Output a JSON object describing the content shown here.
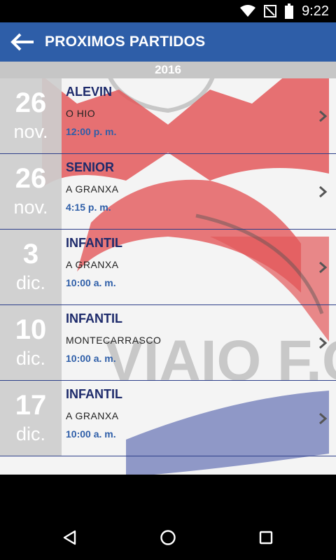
{
  "status_bar": {
    "time": "9:22",
    "icons": [
      "wifi-icon",
      "signal-no-data-icon",
      "battery-icon"
    ]
  },
  "app_bar": {
    "title": "PROXIMOS PARTIDOS",
    "back_icon": "arrow-left-icon"
  },
  "year": "2016",
  "watermark_text": "VIAIO F.C.",
  "matches": [
    {
      "day": "26",
      "month": "nov.",
      "category": "ALEVIN",
      "place": "O HIO",
      "time": "12:00 p. m."
    },
    {
      "day": "26",
      "month": "nov.",
      "category": "SENIOR",
      "place": "A GRANXA",
      "time": "4:15 p. m."
    },
    {
      "day": "3",
      "month": "dic.",
      "category": "INFANTIL",
      "place": "A GRANXA",
      "time": "10:00 a. m."
    },
    {
      "day": "10",
      "month": "dic.",
      "category": "INFANTIL",
      "place": "MONTECARRASCO",
      "time": "10:00 a. m."
    },
    {
      "day": "17",
      "month": "dic.",
      "category": "INFANTIL",
      "place": "A GRANXA",
      "time": "10:00 a. m."
    }
  ],
  "nav_bar": [
    "back-triangle-icon",
    "home-circle-icon",
    "recents-square-icon"
  ],
  "colors": {
    "app_bar": "#2e5ea8",
    "category_text": "#1d2a6b",
    "time_text": "#2e5ea8",
    "date_box": "#cdcdcd",
    "divider": "#2d3f8a"
  }
}
